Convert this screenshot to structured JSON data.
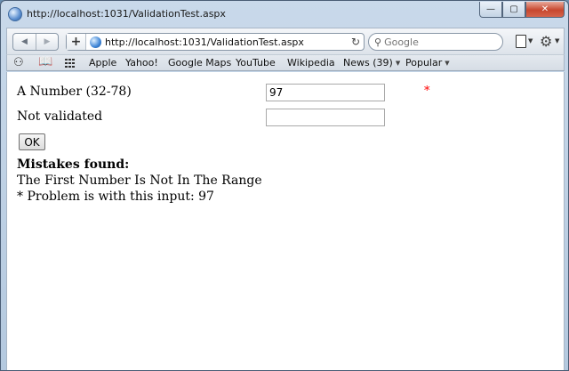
{
  "window": {
    "title": "http://localhost:1031/ValidationTest.aspx",
    "minimize_glyph": "—",
    "maximize_glyph": "▢",
    "close_glyph": "✕"
  },
  "toolbar": {
    "back_glyph": "◀",
    "forward_glyph": "▶",
    "add_glyph": "+",
    "address": "http://localhost:1031/ValidationTest.aspx",
    "reload_glyph": "↻",
    "search_icon_glyph": "⚲",
    "search_placeholder": "Google",
    "gear_glyph": "⚙",
    "caret_glyph": "▼"
  },
  "bookmarks": {
    "reading_list_glyph": "⚇",
    "bookmarks_glyph": "📖",
    "items": [
      {
        "label": "Apple"
      },
      {
        "label": "Yahoo!"
      },
      {
        "label": "Google Maps"
      },
      {
        "label": "YouTube"
      },
      {
        "label": "Wikipedia"
      },
      {
        "label": "News (39)"
      },
      {
        "label": "Popular"
      }
    ]
  },
  "form": {
    "number_label": "A Number (32-78)",
    "number_value": "97",
    "number_error_marker": "*",
    "other_label": "Not validated",
    "other_value": "",
    "ok_label": "OK"
  },
  "summary": {
    "title": "Mistakes found:",
    "lines": [
      "The First Number Is Not In The Range",
      "* Problem is with this input: 97"
    ]
  },
  "colors": {
    "error": "#ff0000"
  }
}
